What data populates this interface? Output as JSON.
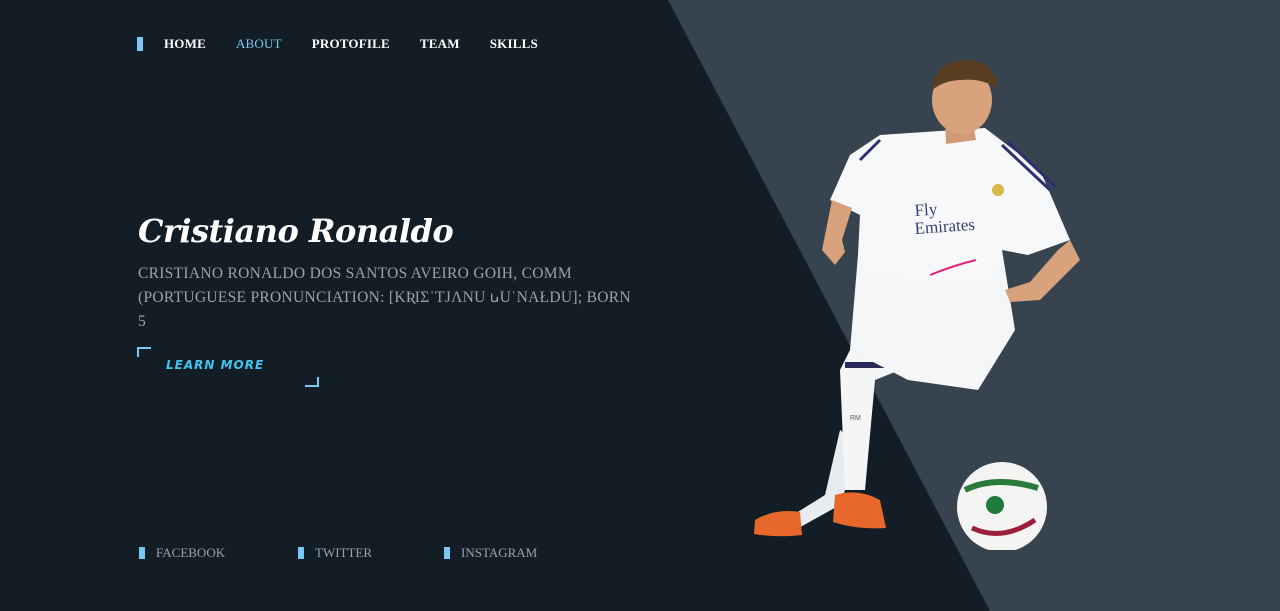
{
  "nav": {
    "items": [
      {
        "label": "HOME",
        "active": false
      },
      {
        "label": "ABOUT",
        "active": true
      },
      {
        "label": "PROTOFILE",
        "active": false
      },
      {
        "label": "TEAM",
        "active": false
      },
      {
        "label": "SKILLS",
        "active": false
      }
    ]
  },
  "hero": {
    "title": "Cristiano Ronaldo",
    "description": "CRISTIANO RONALDO DOS SANTOS AVEIRO GOIH, COMM (PORTUGUESE PRONUNCIATION: [KƦIƩˈTJɅNU ꭎUˈNAŁDU]; BORN 5",
    "cta_label": "LEARN MORE"
  },
  "social": {
    "items": [
      {
        "label": "FACEBOOK",
        "icon": "bar-marker-icon"
      },
      {
        "label": "TWITTER",
        "icon": "bar-marker-icon"
      },
      {
        "label": "INSTAGRAM",
        "icon": "bar-marker-icon"
      }
    ]
  },
  "player_image": {
    "alt": "Footballer in white kit dribbling a ball",
    "shirt_text": "Fly Emirates",
    "short_text": "RM"
  },
  "colors": {
    "background_dark": "#121d26",
    "background_panel": "#37434e",
    "accent": "#7cc6f5",
    "cta": "#3fc6ee",
    "muted_text": "#9aa3ab"
  }
}
